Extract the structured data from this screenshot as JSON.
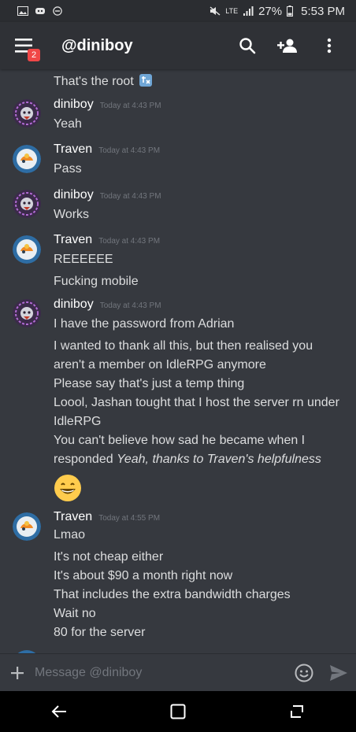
{
  "status": {
    "battery": "27%",
    "time": "5:53 PM",
    "network": "LTE"
  },
  "header": {
    "title": "@diniboy",
    "menu_badge": "2",
    "icons": [
      "menu-icon",
      "search-icon",
      "add-friend-icon",
      "more-icon"
    ]
  },
  "messages": {
    "partial_top": "That's the root",
    "groups": [
      {
        "author": "diniboy",
        "time": "Today at 4:43 PM",
        "lines": [
          "Yeah"
        ]
      },
      {
        "author": "Traven",
        "time": "Today at 4:43 PM",
        "lines": [
          "Pass"
        ]
      },
      {
        "author": "diniboy",
        "time": "Today at 4:43 PM",
        "lines": [
          "Works"
        ]
      },
      {
        "author": "Traven",
        "time": "Today at 4:43 PM",
        "lines": [
          "REEEEEE",
          "Fucking mobile"
        ]
      },
      {
        "author": "diniboy",
        "time": "Today at 4:43 PM",
        "lines": [
          "I have the password from Adrian",
          "I wanted to thank all this, but then realised you",
          "aren't a member on IdleRPG anymore",
          "Please say that's just a temp thing",
          "Loool, Jashan tought that I host the server rn under",
          "IdleRPG",
          "You can't believe how sad he became when I",
          "responded "
        ],
        "italic": "Yeah, thanks to Traven's helpfulness"
      },
      {
        "author": "Traven",
        "time": "Today at 4:55 PM",
        "lines": [
          "Lmao",
          "It's not cheap either",
          "It's about $90 a month right now",
          "That includes the extra bandwidth charges",
          "Wait no",
          "80 for the server"
        ]
      }
    ]
  },
  "composer": {
    "placeholder": "Message @diniboy"
  },
  "colors": {
    "background": "#36393f",
    "header": "#2f3136",
    "badge": "#f04747",
    "emoji": "#ffcc4d"
  }
}
